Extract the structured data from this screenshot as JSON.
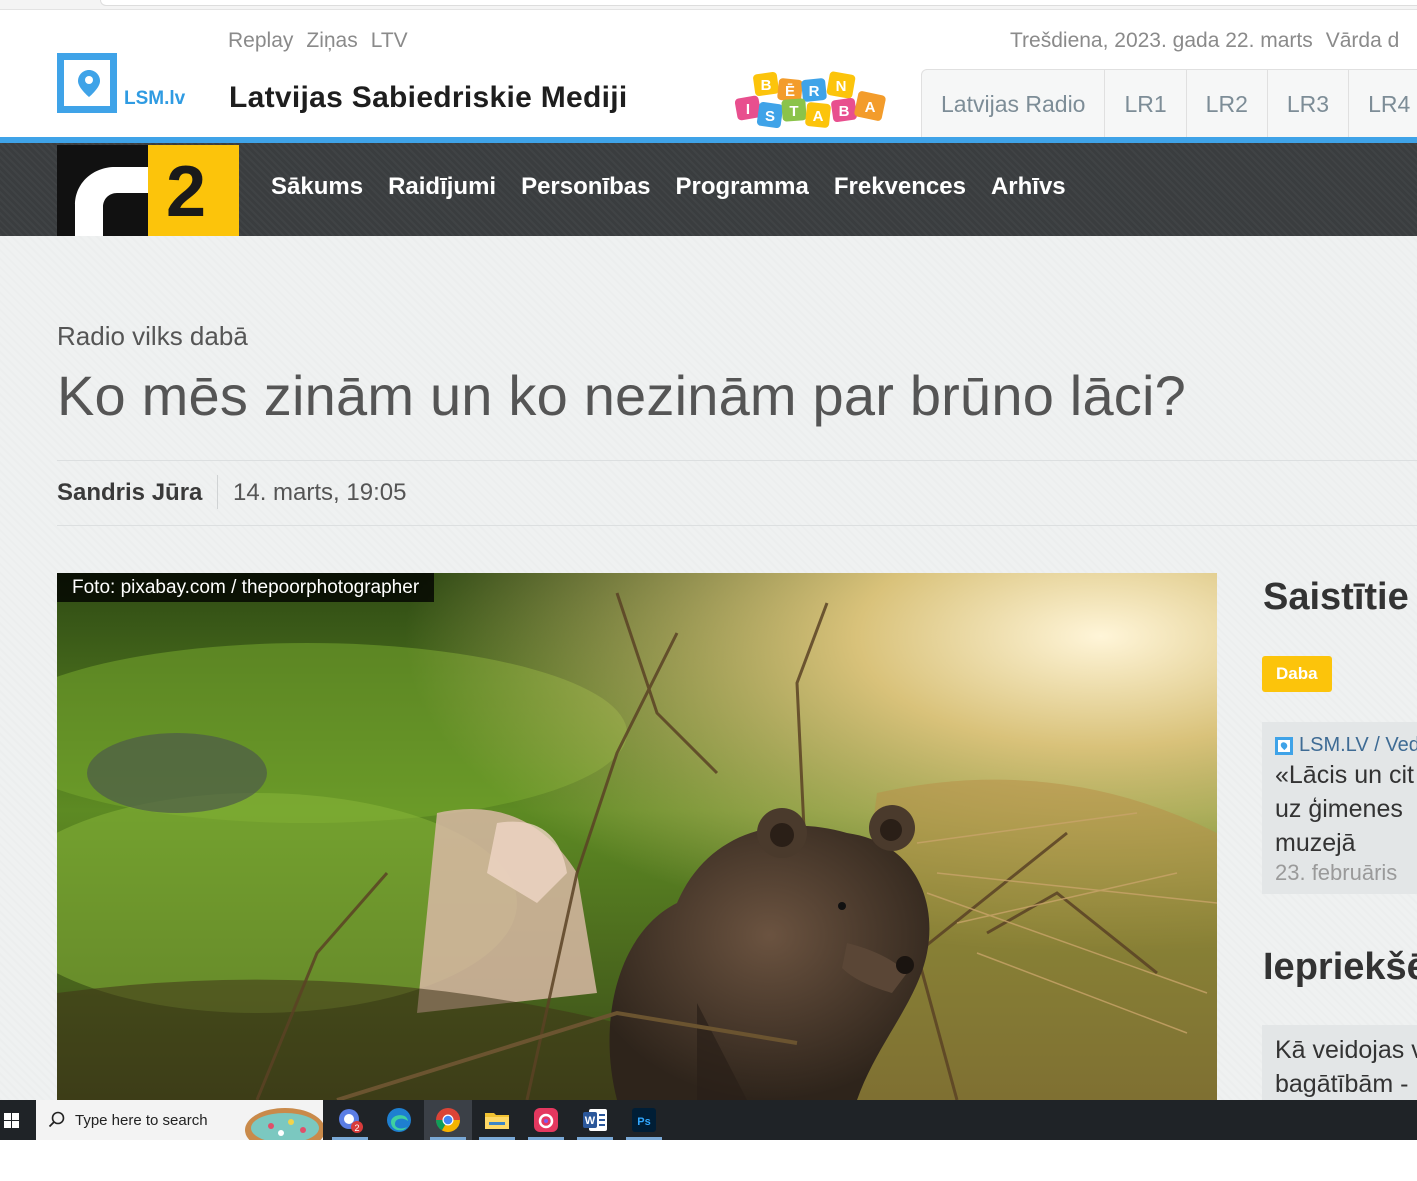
{
  "header": {
    "top_links": [
      "Replay",
      "Ziņas",
      "LTV"
    ],
    "logo_text": "LSM.lv",
    "site_title": "Latvijas Sabiedriskie Mediji",
    "date": "Trešdiena, 2023. gada 22. marts",
    "name_day_label": "Vārda d",
    "kids_letters": [
      "B",
      "Ē",
      "R",
      "N",
      "I",
      "S",
      "T",
      "A",
      "B",
      "A"
    ],
    "radio_tabs": [
      "Latvijas Radio",
      "LR1",
      "LR2",
      "LR3",
      "LR4"
    ]
  },
  "nav": {
    "logo_number": "2",
    "items": [
      "Sākums",
      "Raidījumi",
      "Personības",
      "Programma",
      "Frekvences",
      "Arhīvs"
    ]
  },
  "article": {
    "kicker": "Radio vilks dabā",
    "headline": "Ko mēs zinām un ko nezinām par brūno lāci?",
    "author": "Sandris Jūra",
    "published": "14. marts, 19:05",
    "photo_credit": "Foto: pixabay.com / thepoorphotographer"
  },
  "sidebar": {
    "related_title": "Saistītie r",
    "tag": "Daba",
    "related_source": "LSM.LV / Ved",
    "related_lines": [
      "«Lācis un cit",
      "uz ģimenes",
      "muzejā"
    ],
    "related_date": "23. februāris",
    "previous_title": "Iepriekšē",
    "previous_lines": [
      "Kā veidojas v",
      "bagātībām -"
    ]
  },
  "taskbar": {
    "search_placeholder": "Type here to search",
    "teams_badge": "2",
    "word_letter": "W",
    "ps_letters": "Ps"
  },
  "colors": {
    "lsm_blue": "#3fa3e8",
    "lr2_yellow": "#fcc40b",
    "nav_dark": "#3a3d3f",
    "taskbar": "#1f2327"
  }
}
